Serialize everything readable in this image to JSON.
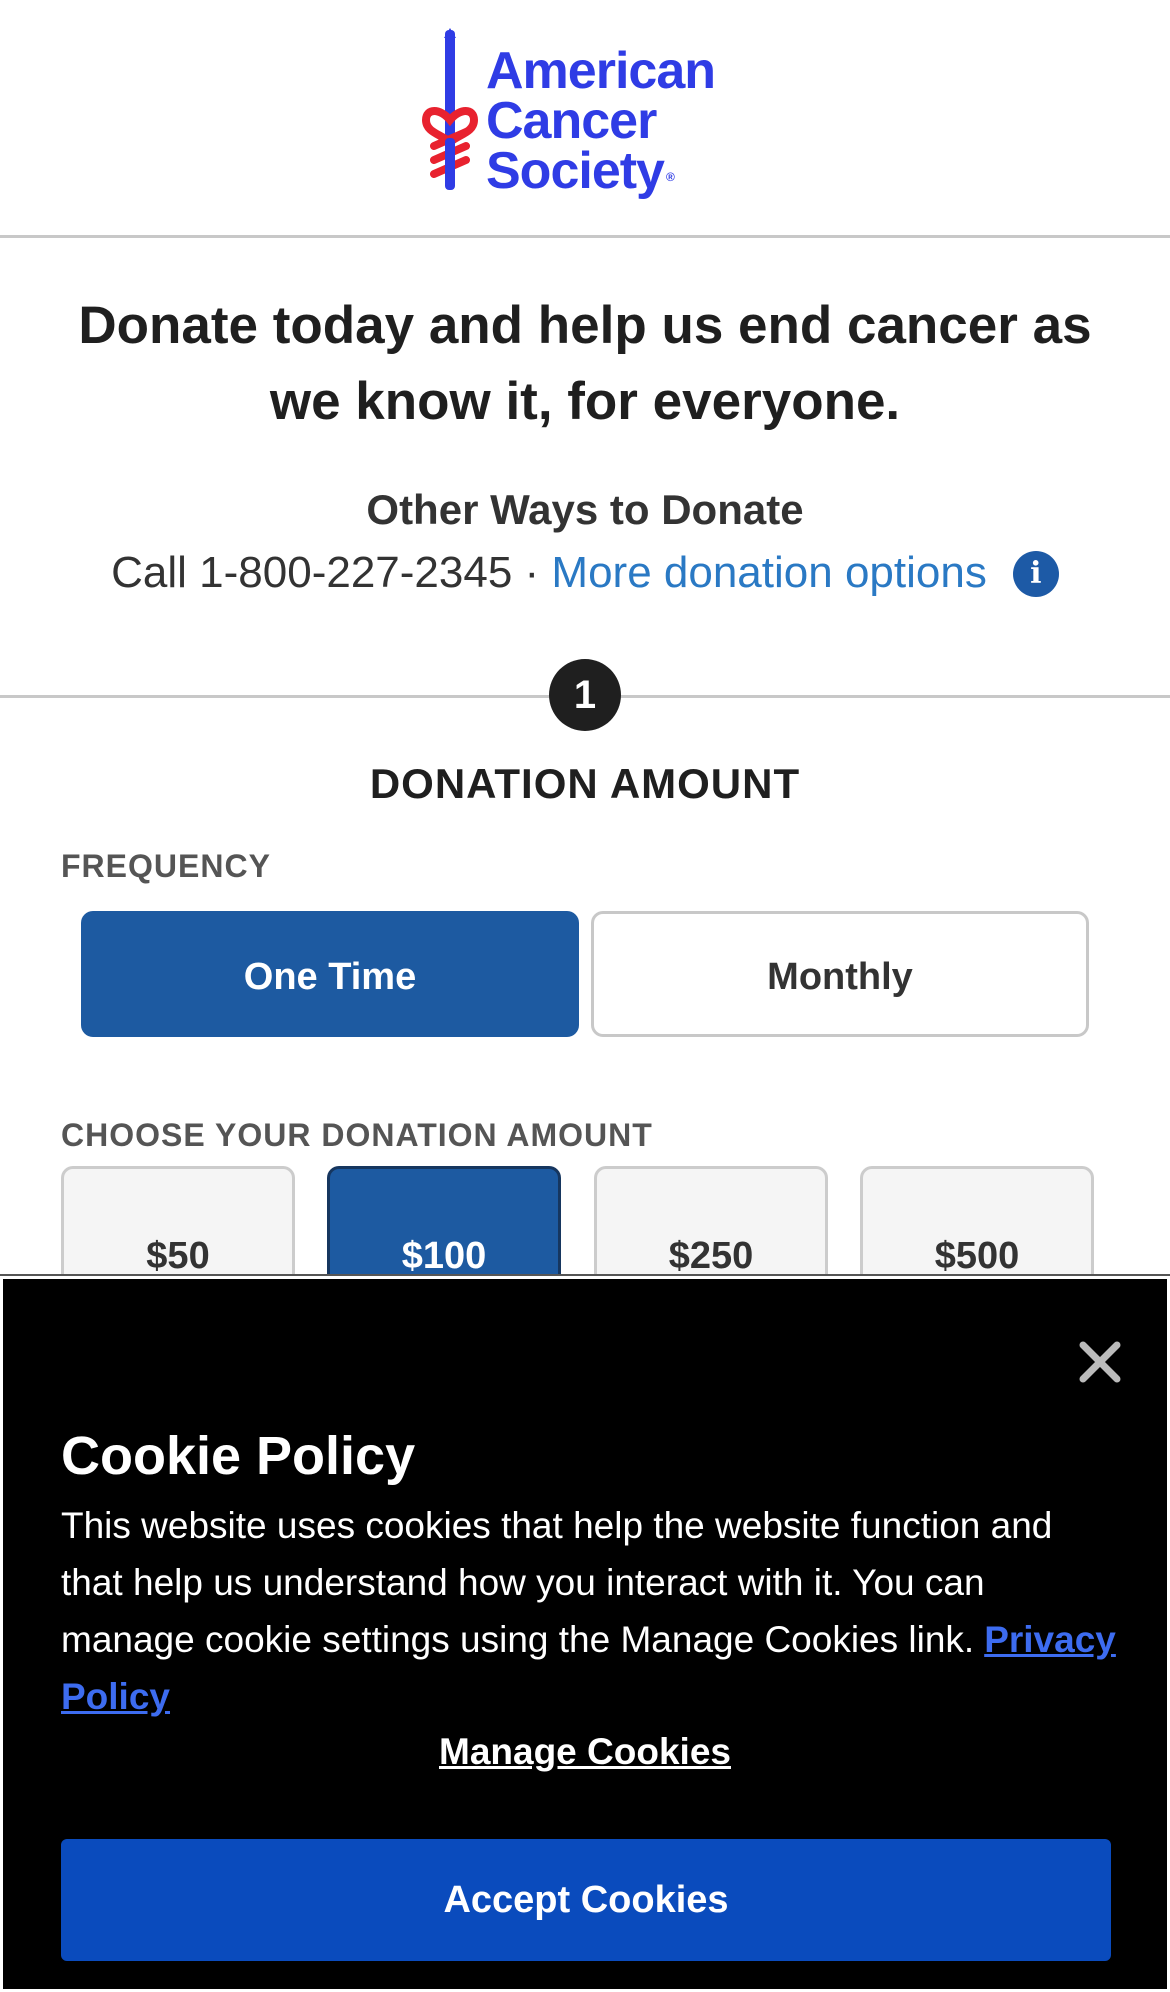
{
  "header": {
    "logo_line1": "American",
    "logo_line2": "Cancer",
    "logo_line3": "Society",
    "logo_mark": "®",
    "brand_color": "#2f3ce5"
  },
  "intro": {
    "headline": "Donate today and help us end cancer as we know it, for everyone.",
    "other_ways_title": "Other Ways to Donate",
    "call_text": "Call 1-800-227-2345 · ",
    "more_options_link": "More donation options",
    "info_icon": "info-icon",
    "info_glyph": "i"
  },
  "step": {
    "number": "1",
    "title": "DONATION AMOUNT"
  },
  "frequency": {
    "label": "FREQUENCY",
    "options": [
      "One Time",
      "Monthly"
    ],
    "selected": "One Time"
  },
  "amount": {
    "label": "CHOOSE YOUR DONATION AMOUNT",
    "options": [
      "$50",
      "$100",
      "$250",
      "$500"
    ],
    "selected": "$100"
  },
  "cookie_banner": {
    "close_icon": "close-icon",
    "title": "Cookie Policy",
    "body": "This website uses cookies that help the website function and that help us understand how you interact with it. You can manage cookie settings using the Manage Cookies link.",
    "privacy_link": "Privacy Policy",
    "manage_link": "Manage Cookies",
    "accept_button": "Accept Cookies",
    "accent_color": "#0a4bbd"
  }
}
